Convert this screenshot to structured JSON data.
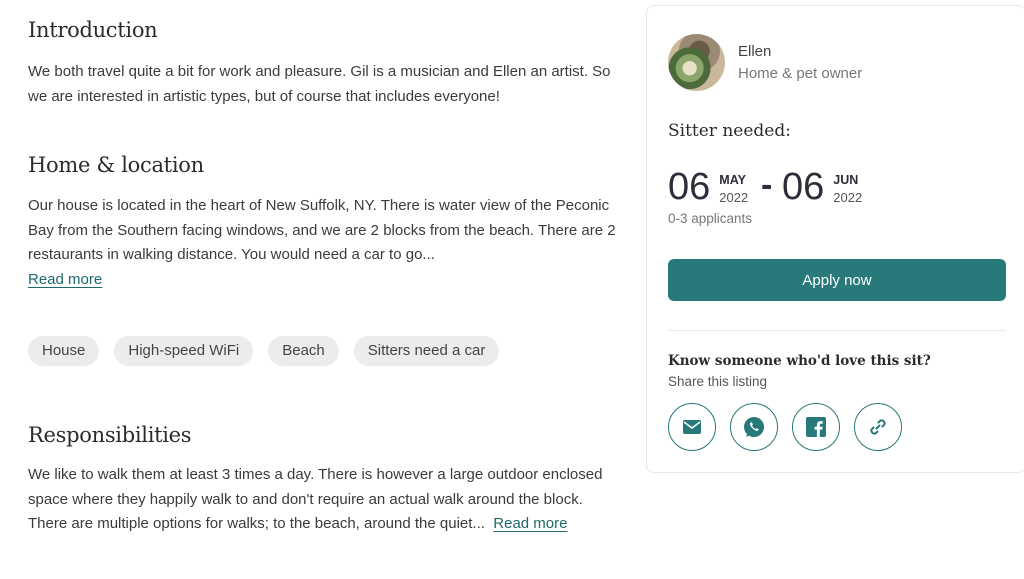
{
  "intro": {
    "title": "Introduction",
    "text": "We both travel quite a bit for work and pleasure. Gil is a musician and Ellen an artist. So we are interested in artistic types, but of course that includes everyone!"
  },
  "home": {
    "title": "Home & location",
    "text": "Our house is located in the heart of New Suffolk, NY. There is water view of the Peconic Bay from the Southern facing windows, and we are 2 blocks from the beach. There are 2 restaurants in walking distance. You would need a car to go...",
    "read_more": "Read more"
  },
  "tags": [
    "House",
    "High-speed WiFi",
    "Beach",
    "Sitters need a car"
  ],
  "responsibilities": {
    "title": "Responsibilities",
    "text": "We like to walk them at least 3 times a day. There is however a large outdoor enclosed space where they happily walk to and don't require an actual walk around the block. There are multiple options for walks; to the beach, around the quiet...",
    "read_more": "Read more"
  },
  "card": {
    "owner_name": "Ellen",
    "owner_role": "Home & pet owner",
    "sitter_needed": "Sitter needed:",
    "start": {
      "day": "06",
      "month": "MAY",
      "year": "2022"
    },
    "dash": "-",
    "end": {
      "day": "06",
      "month": "JUN",
      "year": "2022"
    },
    "applicants": "0-3 applicants",
    "apply_label": "Apply now",
    "know_title": "Know someone who'd love this sit?",
    "share_label": "Share this listing",
    "share_icons": [
      "email-icon",
      "whatsapp-icon",
      "facebook-icon",
      "link-icon"
    ],
    "accent_color": "#27797a"
  }
}
